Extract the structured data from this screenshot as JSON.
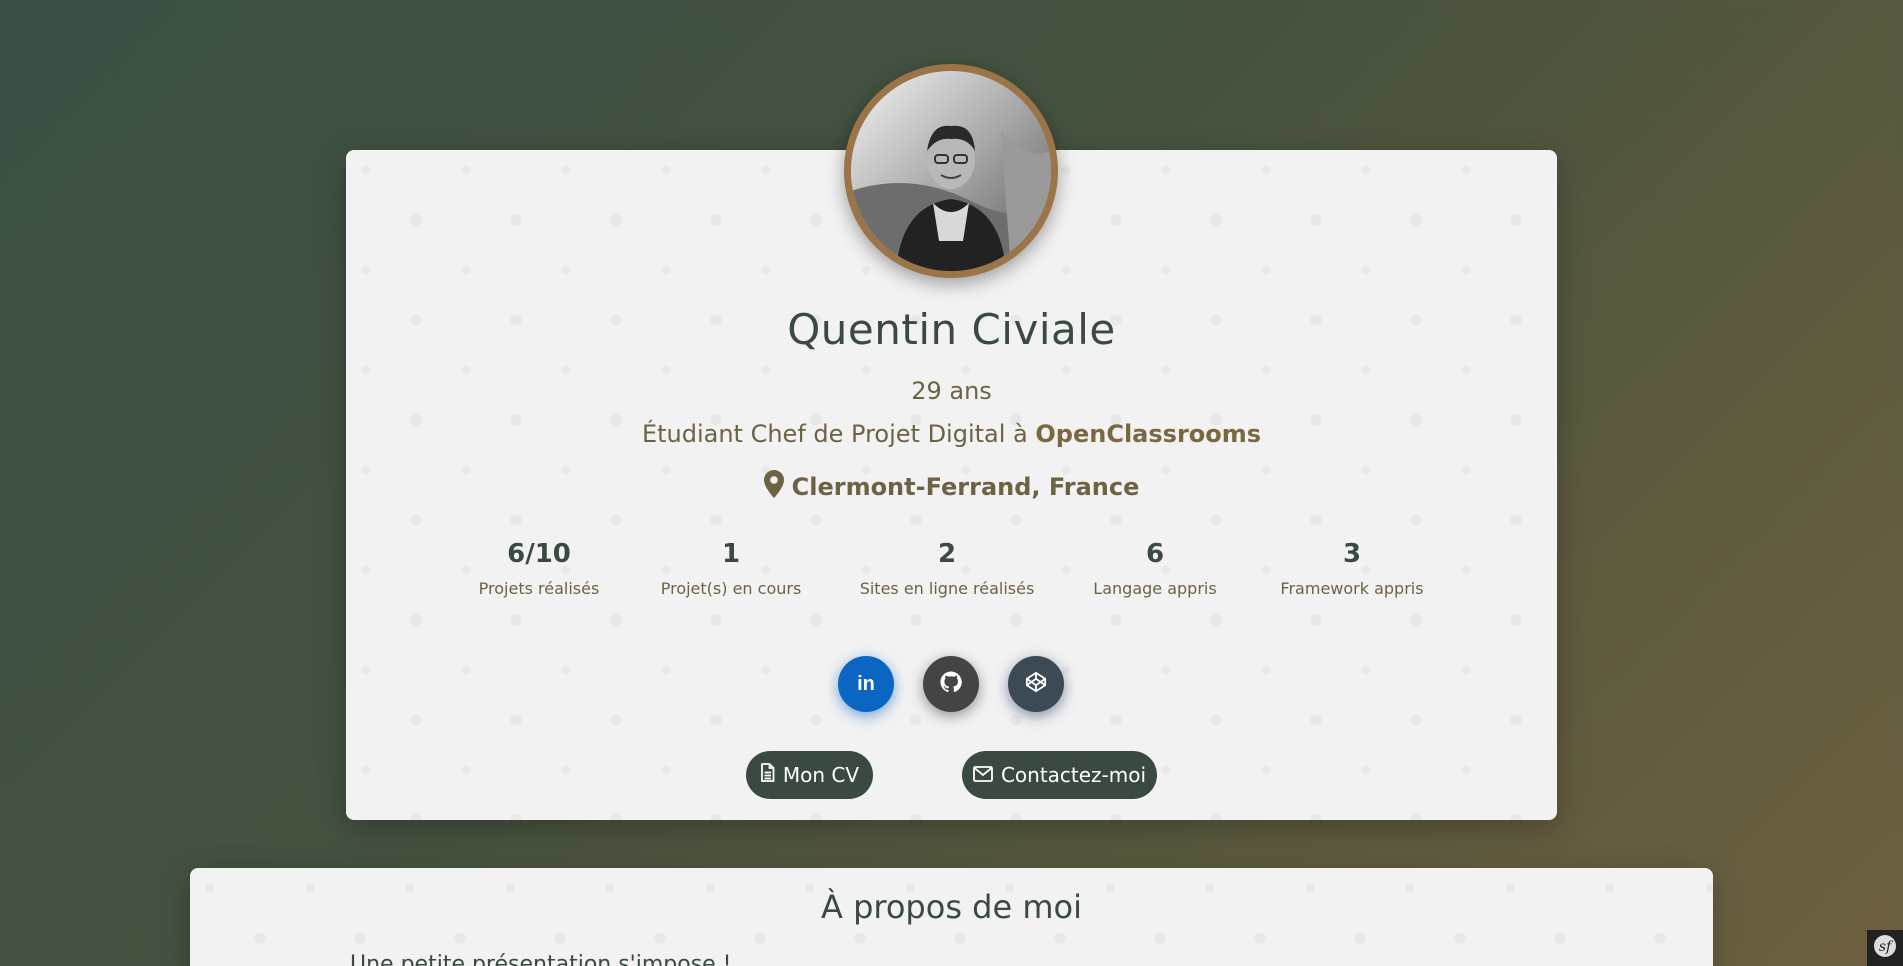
{
  "profile": {
    "name": "Quentin Civiale",
    "age": "29 ans",
    "job_prefix": "Étudiant Chef de Projet Digital à",
    "company": "OpenClassrooms",
    "location": "Clermont-Ferrand, France"
  },
  "stats": [
    {
      "value": "6/10",
      "label": "Projets réalisés"
    },
    {
      "value": "1",
      "label": "Projet(s) en cours"
    },
    {
      "value": "2",
      "label": "Sites en ligne réalisés"
    },
    {
      "value": "6",
      "label": "Langage appris"
    },
    {
      "value": "3",
      "label": "Framework appris"
    }
  ],
  "social": [
    {
      "name": "linkedin",
      "icon": "linkedin-icon",
      "text": "in",
      "color": "#0a66c2"
    },
    {
      "name": "github",
      "icon": "github-icon",
      "color": "#444444"
    },
    {
      "name": "codepen",
      "icon": "codepen-icon",
      "color": "#3b4a55"
    }
  ],
  "buttons": {
    "cv_label": "Mon CV",
    "contact_label": "Contactez-moi"
  },
  "about": {
    "title": "À propos de moi",
    "intro": "Une petite présentation s'impose !"
  },
  "colors": {
    "primary": "#3a4a40",
    "accent": "#6e6244",
    "avatar_border": "#9b7448",
    "card_bg": "#f2f2f2"
  }
}
